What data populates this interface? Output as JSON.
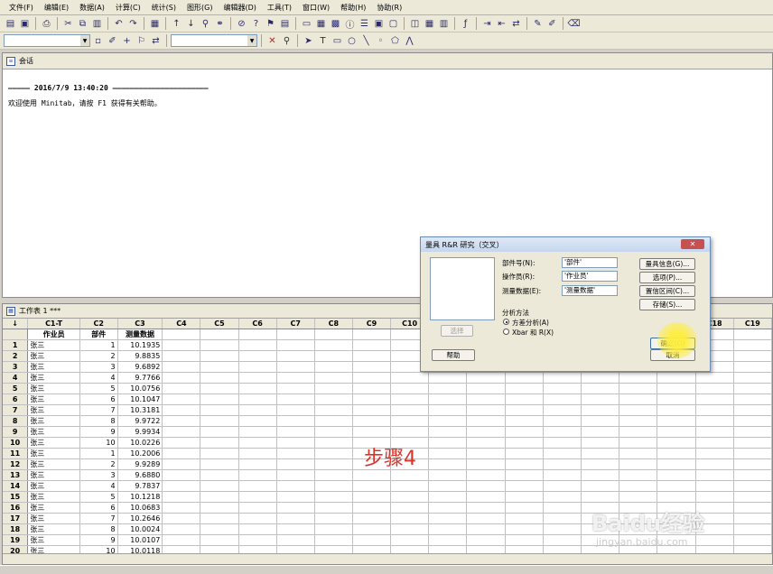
{
  "menu": [
    "文件(F)",
    "编辑(E)",
    "数据(A)",
    "计算(C)",
    "统计(S)",
    "图形(G)",
    "编辑器(D)",
    "工具(T)",
    "窗口(W)",
    "帮助(H)",
    "协助(R)"
  ],
  "session": {
    "title": "会话",
    "timestamp_line": "————— 2016/7/9 13:40:20 ——————————————————————",
    "welcome": "欢迎使用 Minitab，请按 F1 获得有关帮助。"
  },
  "worksheet": {
    "title": "工作表 1 ***",
    "corner": "↓",
    "columns": [
      "C1-T",
      "C2",
      "C3",
      "C4",
      "C5",
      "C6",
      "C7",
      "C8",
      "C9",
      "C10",
      "C11",
      "C12",
      "C13",
      "C14",
      "C15",
      "C16",
      "C17",
      "C18",
      "C19"
    ],
    "names": [
      "作业员",
      "部件",
      "测量数据"
    ],
    "rows": [
      [
        "1",
        "张三",
        "1",
        "10.1935"
      ],
      [
        "2",
        "张三",
        "2",
        "9.8835"
      ],
      [
        "3",
        "张三",
        "3",
        "9.6892"
      ],
      [
        "4",
        "张三",
        "4",
        "9.7766"
      ],
      [
        "5",
        "张三",
        "5",
        "10.0756"
      ],
      [
        "6",
        "张三",
        "6",
        "10.1047"
      ],
      [
        "7",
        "张三",
        "7",
        "10.3181"
      ],
      [
        "8",
        "张三",
        "8",
        "9.9722"
      ],
      [
        "9",
        "张三",
        "9",
        "9.9934"
      ],
      [
        "10",
        "张三",
        "10",
        "10.0226"
      ],
      [
        "11",
        "张三",
        "1",
        "10.2006"
      ],
      [
        "12",
        "张三",
        "2",
        "9.9289"
      ],
      [
        "13",
        "张三",
        "3",
        "9.6880"
      ],
      [
        "14",
        "张三",
        "4",
        "9.7837"
      ],
      [
        "15",
        "张三",
        "5",
        "10.1218"
      ],
      [
        "16",
        "张三",
        "6",
        "10.0683"
      ],
      [
        "17",
        "张三",
        "7",
        "10.2646"
      ],
      [
        "18",
        "张三",
        "8",
        "10.0024"
      ],
      [
        "19",
        "张三",
        "9",
        "10.0107"
      ],
      [
        "20",
        "张三",
        "10",
        "10.0118"
      ]
    ]
  },
  "step_label": "步骤4",
  "dialog": {
    "title": "量具 R&R 研究（交叉）",
    "close": "✕",
    "part_label": "部件号(N):",
    "part_value": "'部件'",
    "operator_label": "操作员(R):",
    "operator_value": "'作业员'",
    "measure_label": "测量数据(E):",
    "measure_value": "'测量数据'",
    "method_label": "分析方法",
    "method_anova": "方差分析(A)",
    "method_xbar": "Xbar 和 R(X)",
    "select_btn": "选择",
    "help_btn": "帮助",
    "gage_info_btn": "量具信息(G)...",
    "options_btn": "选项(P)...",
    "conf_btn": "置信区间(C)...",
    "storage_btn": "存储(S)...",
    "ok_btn": "确定(O)",
    "cancel_btn": "取消"
  },
  "watermark": "Baidu经验",
  "watermark_sub": "jingyan.baidu.com"
}
